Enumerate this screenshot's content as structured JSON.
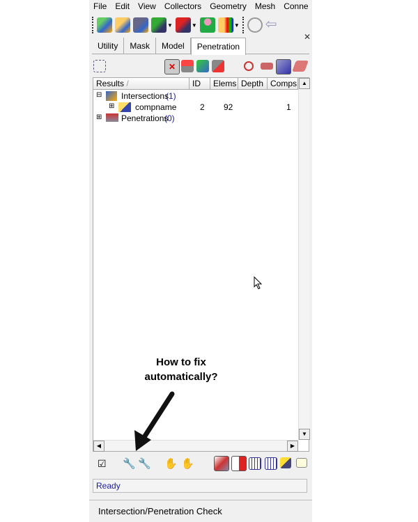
{
  "menu": [
    "File",
    "Edit",
    "View",
    "Collectors",
    "Geometry",
    "Mesh",
    "Conne"
  ],
  "toolbar1": [
    "new-model-icon",
    "open-model-icon",
    "save-model-icon",
    "import-icon",
    "export-icon",
    "user-profile-icon",
    "results-folder-icon",
    "zoom-icon",
    "back-arrow-icon"
  ],
  "tabs": [
    {
      "label": "Utility"
    },
    {
      "label": "Mask"
    },
    {
      "label": "Model"
    },
    {
      "label": "Penetration",
      "active": true
    }
  ],
  "table": {
    "headers": [
      "Results",
      "ID",
      "Elems",
      "Depth",
      "Comps"
    ],
    "rows": [
      {
        "name": "Intersections",
        "count": "(1)",
        "id": "",
        "elems": "",
        "depth": "",
        "comps": ""
      },
      {
        "name": "compname",
        "count": "",
        "id": "2",
        "elems": "92",
        "depth": "",
        "comps": "1"
      },
      {
        "name": "Penetrations",
        "count": "(0)",
        "id": "",
        "elems": "",
        "depth": "",
        "comps": ""
      }
    ]
  },
  "status": "Ready",
  "footer": "Intersection/Penetration Check",
  "annotation": {
    "line1": "How to fix",
    "line2": "automatically?"
  },
  "colors": {
    "panel": "#f0f0f0",
    "status_text": "#1a1aa8"
  }
}
